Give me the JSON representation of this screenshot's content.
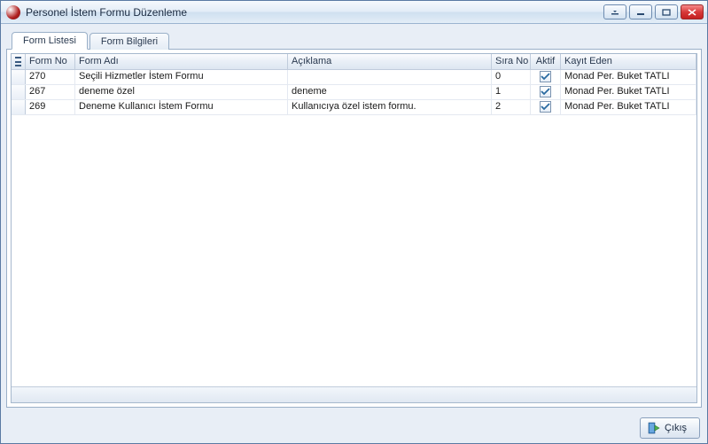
{
  "window": {
    "title": "Personel İstem Formu Düzenleme"
  },
  "tabs": [
    {
      "label": "Form Listesi",
      "active": true
    },
    {
      "label": "Form Bilgileri",
      "active": false
    }
  ],
  "columns": {
    "form_no": "Form No",
    "form_adi": "Form Adı",
    "aciklama": "Açıklama",
    "sira_no": "Sıra No",
    "aktif": "Aktif",
    "kayit_eden": "Kayıt Eden"
  },
  "rows": [
    {
      "form_no": "270",
      "form_adi": "Seçili Hizmetler İstem Formu",
      "aciklama": "",
      "sira_no": "0",
      "aktif": true,
      "kayit_eden": "Monad Per. Buket TATLI"
    },
    {
      "form_no": "267",
      "form_adi": "deneme özel",
      "aciklama": "deneme",
      "sira_no": "1",
      "aktif": true,
      "kayit_eden": "Monad Per. Buket TATLI"
    },
    {
      "form_no": "269",
      "form_adi": "Deneme Kullanıcı İstem Formu",
      "aciklama": "Kullanıcıya özel istem formu.",
      "sira_no": "2",
      "aktif": true,
      "kayit_eden": "Monad Per. Buket TATLI"
    }
  ],
  "buttons": {
    "exit": "Çıkış"
  }
}
